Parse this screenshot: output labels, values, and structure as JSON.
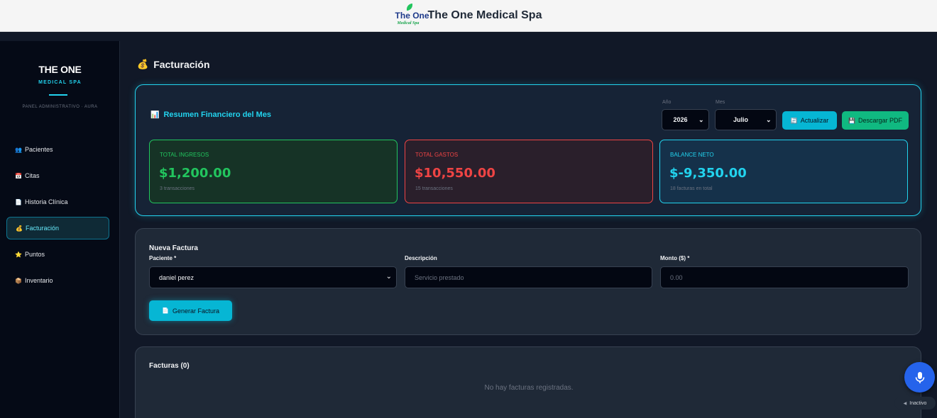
{
  "header": {
    "logo_text": "The One",
    "logo_sub": "Medical Spa",
    "title": "The One Medical Spa"
  },
  "sidebar": {
    "brand_title": "THE ONE",
    "brand_subtitle": "MEDICAL SPA",
    "panel_label": "PANEL ADMINISTRATIVO · AURA",
    "items": [
      {
        "icon": "👥",
        "label": "Pacientes",
        "active": false
      },
      {
        "icon": "📅",
        "label": "Citas",
        "active": false
      },
      {
        "icon": "📄",
        "label": "Historia Clínica",
        "active": false
      },
      {
        "icon": "💰",
        "label": "Facturación",
        "active": true
      },
      {
        "icon": "⭐",
        "label": "Puntos",
        "active": false
      },
      {
        "icon": "📦",
        "label": "Inventario",
        "active": false
      }
    ]
  },
  "page": {
    "icon": "💰",
    "title": "Facturación"
  },
  "summary": {
    "icon": "📊",
    "title": "Resumen Financiero del Mes",
    "year_label": "Año",
    "year_value": "2026",
    "month_label": "Mes",
    "month_value": "Julio",
    "refresh_icon": "🔄",
    "refresh_label": "Actualizar",
    "download_icon": "💾",
    "download_label": "Descargar PDF",
    "income": {
      "label": "TOTAL INGRESOS",
      "value": "$1,200.00",
      "sub": "3 transacciones",
      "color": "#22c55e"
    },
    "expenses": {
      "label": "TOTAL GASTOS",
      "value": "$10,550.00",
      "sub": "15 transacciones",
      "color": "#ef4444"
    },
    "balance": {
      "label": "BALANCE NETO",
      "value": "$-9,350.00",
      "sub": "18 facturas en total",
      "color": "#22d3ee"
    }
  },
  "new_invoice": {
    "heading": "Nueva Factura",
    "patient_label": "Paciente *",
    "patient_value": "daniel perez",
    "description_label": "Descripción",
    "description_placeholder": "Servicio prestado",
    "amount_label": "Monto ($) *",
    "amount_placeholder": "0.00",
    "generate_icon": "📄",
    "generate_label": "Generar Factura"
  },
  "invoices": {
    "heading": "Facturas (0)",
    "empty_message": "No hay facturas registradas."
  },
  "voice": {
    "icon": "microphone-icon",
    "status": "Inactivo",
    "accent": "#2563eb"
  }
}
